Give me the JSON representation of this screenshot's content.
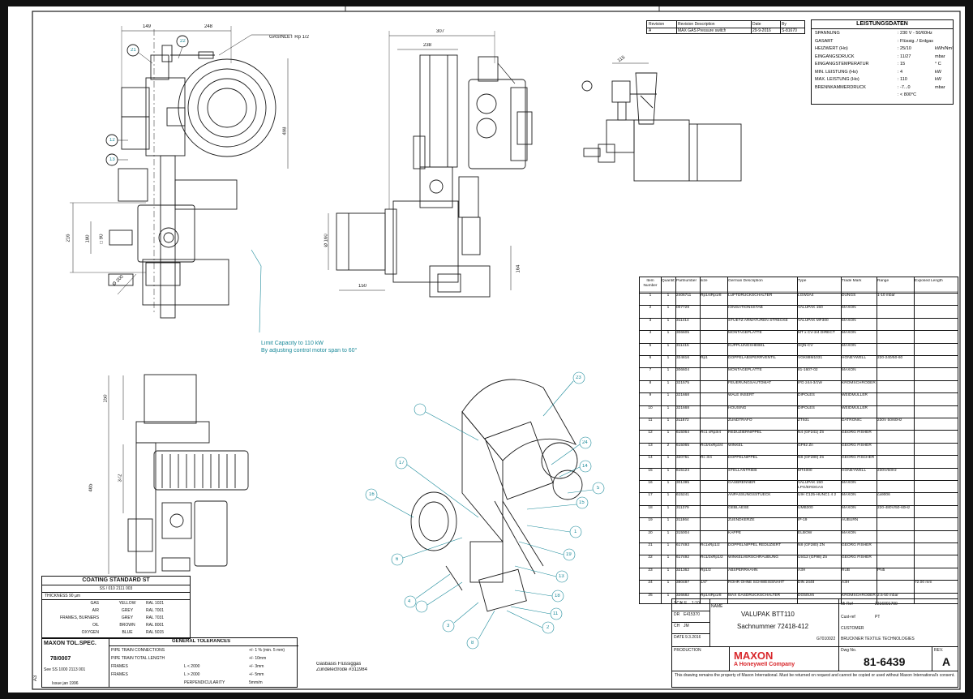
{
  "dimensions": {
    "front": [
      "149",
      "248",
      "498",
      "Ø 200"
    ],
    "front_side": [
      "216",
      "180",
      "□ 90"
    ],
    "side": [
      "307",
      "238",
      "Ø 160",
      "150",
      "164"
    ],
    "top_right": [
      "115"
    ],
    "lower": [
      "150",
      "372",
      "465"
    ]
  },
  "gas_inlet_label": "GASINLET Rp 1/2",
  "capacity_note": [
    "Limit Capacity to 110 kW",
    "By adjusting control motor span to 60°"
  ],
  "gas_type_note": [
    "Gasbasis Flüssiggas",
    "Zündelectrode #311984"
  ],
  "balloons": {
    "front": [
      "21",
      "22",
      "12",
      "13"
    ],
    "iso": [
      "23",
      "17",
      "16",
      "24",
      "14",
      "5",
      "15",
      "1",
      "19",
      "13",
      "18",
      "11",
      "2",
      "6",
      "4",
      "3",
      "8"
    ]
  },
  "revision": {
    "headers": [
      "Revision",
      "Revision Description",
      "Date",
      "By"
    ],
    "row": [
      "A",
      "MAX GAS Pressure switch",
      "29-9-2016",
      "S-81670"
    ]
  },
  "leistungsdaten": {
    "title": "LEISTUNGSDATEN",
    "rows": [
      {
        "label": "SPANNUNG",
        "value": ": 230 V - 50/60Hz",
        "unit": ""
      },
      {
        "label": "GASART",
        "value": ": Flüssig. / Erdgas",
        "unit": ""
      },
      {
        "label": "HEIZWERT (Ho)",
        "value": ": 25/10",
        "unit": "kWh/Nm³"
      },
      {
        "label": "EINGANGSDRUCK",
        "value": ": 11/27",
        "unit": "mbar"
      },
      {
        "label": "EINGANGSTEMPERATUR",
        "value": ": 15",
        "unit": "° C"
      },
      {
        "label": "MIN. LEISTUNG (Ho)",
        "value": ": 4",
        "unit": "kW"
      },
      {
        "label": "MAX. LEISTUNG (Ho)",
        "value": ": 110",
        "unit": "kW"
      },
      {
        "label": "BRENNKAMMERDRUCK",
        "value": ": -7...0",
        "unit": "mbar"
      },
      {
        "label": "",
        "value": ": < 800°C",
        "unit": ""
      }
    ]
  },
  "parts_table": {
    "headers": [
      "Item Number",
      "Quantity",
      "Partnumber",
      "size",
      "German Description",
      "Type",
      "Trade Mark",
      "Range",
      "Exposed Length"
    ],
    "rows": [
      [
        "1",
        "1",
        "2406711",
        "Rp1/4Rp1/8",
        "LUFTDRUCKSCHALTER",
        "LGW3A4",
        "DUNGS",
        "1-10 mbar",
        ""
      ],
      [
        "2",
        "1",
        "007729",
        "",
        "IONISATIONSSTAB",
        "VALUPAK 150",
        "MAXON",
        "",
        ""
      ],
      [
        "3",
        "1",
        "311414",
        "",
        "STUETZ ARMATUREN STRECKE",
        "VALUPAK MF300",
        "MAXON",
        "",
        ""
      ],
      [
        "4",
        "1",
        "306605",
        "",
        "MONTAGEPLATTE",
        "MT x CV-3/4 DIRECT",
        "MAXON",
        "",
        ""
      ],
      [
        "5",
        "1",
        "311415",
        "",
        "KUPPLUNGSHEBEL",
        "SQN-CV",
        "MAXON",
        "",
        ""
      ],
      [
        "6",
        "1",
        "324816",
        "Rp1",
        "DOPPELABSPERRVENTIL",
        "VGK88M1031",
        "HONEYWELL",
        "220-240/50-60",
        ""
      ],
      [
        "7",
        "1",
        "306604",
        "",
        "MONTAGEPLATTE",
        "81-1607-02",
        "MAXON",
        "",
        ""
      ],
      [
        "8",
        "1",
        "321575",
        "",
        "FEUERUNGSAUTOMAT",
        "IFD 244-3/1W",
        "KROMSCHRÖDER",
        "",
        ""
      ],
      [
        "9",
        "1",
        "321668",
        "",
        "WALE INSERT",
        "DIPOLES",
        "WEIDMULLER",
        "",
        ""
      ],
      [
        "10",
        "1",
        "321668",
        "",
        "HOUSING",
        "DIPOLES",
        "WEIDMULLER",
        "",
        ""
      ],
      [
        "11",
        "1",
        "311872",
        "",
        "ZUNDTRAFO",
        "ZT931",
        "DATRONIC",
        "230V 50/60Hz",
        ""
      ],
      [
        "12",
        "1",
        "615064",
        "Rc1 xRp3/4",
        "REDUZIERNIPPEL",
        "N4 (GF241) Zn",
        "GEORG FISHER",
        "",
        ""
      ],
      [
        "13",
        "2",
        "615065",
        "Rc3/4xRp3/4",
        "WINKEL",
        "GF92 Zn",
        "GEORG FISHER",
        "",
        ""
      ],
      [
        "14",
        "1",
        "320751",
        "Rc 3/4",
        "DOPPELNIPPEL",
        "N8 (GF280) Zn",
        "GEORG FISCHER",
        "",
        ""
      ],
      [
        "15",
        "1",
        "615124",
        "",
        "STELLANTRIEB",
        "MT4000",
        "HONEYWELL",
        "230V/50Hz",
        ""
      ],
      [
        "16",
        "1",
        "301395",
        "",
        "GASBRENNER",
        "VALUPAK 150 LPG/ERDGAS",
        "MAXON",
        "",
        ""
      ],
      [
        "17",
        "1",
        "615241",
        "",
        "ANPASSUNGSSTUECK",
        "UIH C125-HUNC1 4 2",
        "MAXON",
        "ca9006",
        ""
      ],
      [
        "18",
        "1",
        "311379",
        "",
        "GEBLAESE",
        "UMB300",
        "MAXON",
        "220-480V/50-60Hz",
        ""
      ],
      [
        "19",
        "1",
        "311864",
        "",
        "ZUENDKERZE",
        "IP-19",
        "AUBURN",
        "",
        ""
      ],
      [
        "20",
        "1",
        "315004",
        "",
        "KAPPE",
        "ELBOW",
        "MAXON",
        "",
        ""
      ],
      [
        "21",
        "1",
        "617493",
        "Rc1xRp1/2",
        "DOPPELNIPPEL REDUZIERT",
        "N8 (GF280) ZN",
        "GEORG FISHER",
        "",
        ""
      ],
      [
        "22",
        "1",
        "617492",
        "Rc1/2xRp1/2",
        "WINKELVERSCHRAUBUNG",
        "UI412 (GF98) Zn",
        "GEORG FISHER",
        "",
        ""
      ],
      [
        "23",
        "1",
        "321362",
        "Rp1/2",
        "ABSPERRHAHN",
        "A3H",
        "RUB",
        "PN5",
        ""
      ],
      [
        "24",
        "1",
        "380487",
        "1/4\"",
        "ROHR OHNE SCHWEISSNAHT",
        "DIN 2448",
        "A3H",
        "",
        "72.00 mm"
      ],
      [
        "25",
        "1",
        "326682",
        "Rp1/4Rp1/8",
        "MAX GASDRUCKSCHALTER",
        "DG50U/6",
        "KROMSCHRÖDER",
        "2.5-50 mbar",
        ""
      ]
    ]
  },
  "title_block": {
    "scale_label": "SCALE",
    "scale_value": "1:10",
    "name_label": "NAME",
    "dr_label": "DR",
    "dr_value": "E415370",
    "ch_label": "CH",
    "ch_value": "JM",
    "date_label": "DATE",
    "date_value": "9.3.2016",
    "production_label": "PRODUCTION",
    "production_value": "G7010022",
    "name_line1": "VALUPAK BTT110",
    "name_line2": "Sachnummer 72418-412",
    "mi_ref_label": "Mi-Ref",
    "mi_ref_value": "2216001700",
    "cust_ref_label": "Cust-ref",
    "cust_ref_value": "PT",
    "customer_label": "CUSTOMER",
    "customer_value": "BRÜCKNER TEXTILE TECHNOLOGIES",
    "company": "MAXON",
    "company_sub": "A Honeywell Company",
    "dwg_label": "Dwg No.",
    "dwg_value": "81-6439",
    "rev_label": "REV.",
    "rev_value": "A",
    "disclaimer": "This drawing remains the property of Maxon International. Must be returned on request and cannot be copied or used without Maxon International's consent."
  },
  "coating": {
    "title": "COATING STANDARD ST",
    "sub": "SS / 010 2111 003",
    "thickness": "THICKNESS 90 µm",
    "rows": [
      [
        "GAS",
        "YELLOW",
        "RAL 1021"
      ],
      [
        "AIR",
        "GREY",
        "RAL 7001"
      ],
      [
        "FRAMES, BURNERS",
        "GREY",
        "RAL 7031"
      ],
      [
        "OIL",
        "BROWN",
        "RAL 8001"
      ],
      [
        "OXYGEN",
        "BLUE",
        "RAL 5015"
      ]
    ]
  },
  "tolerances": {
    "spec_title": "MAXON TOL.SPEC.",
    "spec_number": "78/0007",
    "spec_ref": "See SS 1000 2113 001",
    "issue": "Issue jan 1996",
    "title": "GENERAL TOLERANCES",
    "rows": [
      [
        "PIPE TRAIN CONNECTIONS",
        "",
        "+/- 1 % (min. 5 mm)"
      ],
      [
        "PIPE TRAIN TOTAL LENGTH",
        "",
        "+/- 10mm"
      ],
      [
        "FRAMES",
        "L < 2000",
        "+/- 3mm"
      ],
      [
        "FRAMES",
        "L > 2000",
        "+/- 5mm"
      ],
      [
        "",
        "PERPENDICULARITY",
        "5mm/m"
      ]
    ]
  },
  "sheet_marks": [
    "A3"
  ]
}
